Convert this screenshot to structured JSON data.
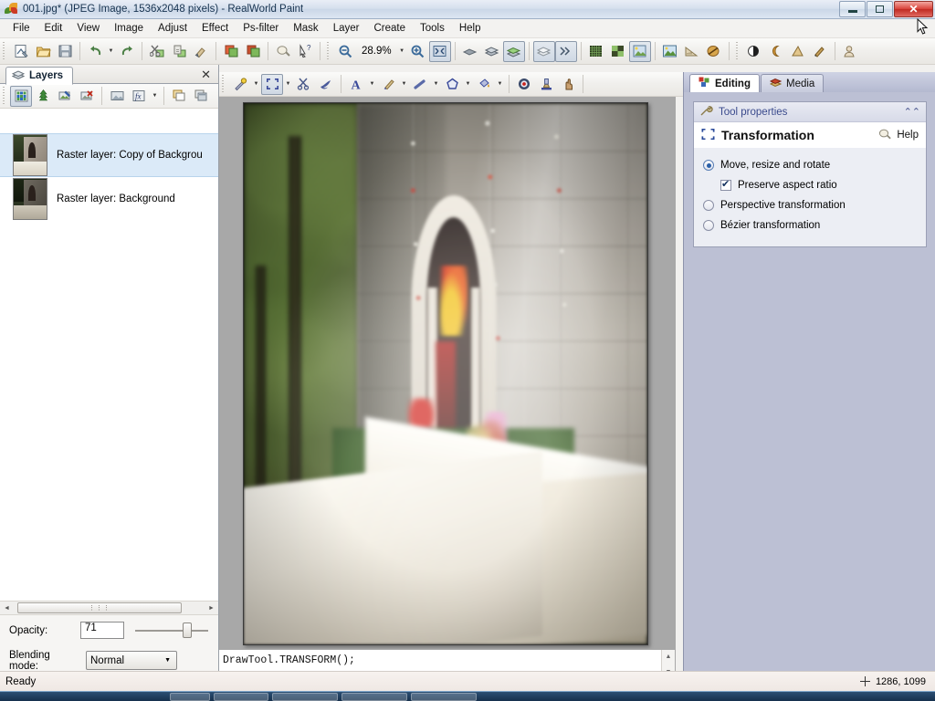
{
  "window": {
    "title": "001.jpg* (JPEG Image, 1536x2048 pixels) - RealWorld Paint",
    "app_icon": "palette-leaf-icon",
    "minimize_label": "Minimize",
    "restore_label": "Restore",
    "close_label": "Close"
  },
  "menu": {
    "items": [
      {
        "label": "File"
      },
      {
        "label": "Edit"
      },
      {
        "label": "View"
      },
      {
        "label": "Image"
      },
      {
        "label": "Adjust"
      },
      {
        "label": "Effect"
      },
      {
        "label": "Ps-filter"
      },
      {
        "label": "Mask"
      },
      {
        "label": "Layer"
      },
      {
        "label": "Create"
      },
      {
        "label": "Tools"
      },
      {
        "label": "Help"
      }
    ]
  },
  "toolbar_main": {
    "zoom_value": "28.9%",
    "buttons": [
      {
        "name": "new-document-icon",
        "title": "New"
      },
      {
        "name": "open-folder-icon",
        "title": "Open"
      },
      {
        "name": "save-disk-icon",
        "title": "Save"
      },
      {
        "name": "undo-icon",
        "title": "Undo"
      },
      {
        "name": "undo-dropdown-icon",
        "title": "Undo history"
      },
      {
        "name": "redo-icon",
        "title": "Redo"
      },
      {
        "name": "cut-scissors-icon",
        "title": "Cut"
      },
      {
        "name": "copy-icon",
        "title": "Copy"
      },
      {
        "name": "paste-brush-icon",
        "title": "Paste"
      },
      {
        "name": "crop-icon",
        "title": "Crop"
      },
      {
        "name": "resize-icon",
        "title": "Resize"
      },
      {
        "name": "color-picker-bulb-icon",
        "title": "Pick color"
      },
      {
        "name": "whats-this-help-icon",
        "title": "What's this?"
      },
      {
        "name": "zoom-out-icon",
        "title": "Zoom out"
      },
      {
        "name": "zoom-dropdown-icon",
        "title": "Zoom presets"
      },
      {
        "name": "zoom-in-icon",
        "title": "Zoom in"
      },
      {
        "name": "fit-to-window-icon",
        "title": "Fit to window"
      },
      {
        "name": "layer-flat-icon",
        "title": "Single layer"
      },
      {
        "name": "layer-stack-icon",
        "title": "Layer stack"
      },
      {
        "name": "layer-active-icon",
        "title": "Active layer"
      },
      {
        "name": "layers-panel-icon",
        "title": "Layers"
      },
      {
        "name": "animation-frames-icon",
        "title": "Frames"
      },
      {
        "name": "grid-fine-icon",
        "title": "Fine grid"
      },
      {
        "name": "grid-coarse-icon",
        "title": "Coarse grid"
      },
      {
        "name": "image-preview-icon",
        "title": "Preview"
      },
      {
        "name": "image-thumbnail-icon",
        "title": "Thumbnail"
      },
      {
        "name": "ruler-icon",
        "title": "Ruler"
      },
      {
        "name": "guides-icon",
        "title": "Guides"
      },
      {
        "name": "brightness-icon",
        "title": "Brightness"
      },
      {
        "name": "contrast-icon",
        "title": "Contrast"
      },
      {
        "name": "gamma-icon",
        "title": "Gamma"
      },
      {
        "name": "eyedropper-icon",
        "title": "Eyedropper"
      },
      {
        "name": "user-profile-icon",
        "title": "Account"
      }
    ]
  },
  "toolbar_tools": {
    "overflow_label": "»",
    "buttons": [
      {
        "name": "magic-wand-icon",
        "title": "Magic wand"
      },
      {
        "name": "selection-transform-icon",
        "title": "Transformation",
        "active": true
      },
      {
        "name": "cut-selection-icon",
        "title": "Cut selection"
      },
      {
        "name": "smudge-icon",
        "title": "Smudge"
      },
      {
        "name": "text-tool-icon",
        "title": "Text"
      },
      {
        "name": "brush-tool-icon",
        "title": "Brush"
      },
      {
        "name": "line-tool-icon",
        "title": "Line"
      },
      {
        "name": "shape-tool-icon",
        "title": "Shape"
      },
      {
        "name": "fill-bucket-icon",
        "title": "Fill"
      },
      {
        "name": "target-icon",
        "title": "Target"
      },
      {
        "name": "stamp-icon",
        "title": "Clone stamp"
      },
      {
        "name": "finger-icon",
        "title": "Finger"
      }
    ]
  },
  "layers_dock": {
    "tab_label": "Layers",
    "tab_icon": "layers-stack-icon",
    "close_icon": "close-icon",
    "toolbar_buttons": [
      {
        "name": "new-layer-icon",
        "title": "New layer"
      },
      {
        "name": "add-vector-layer-icon",
        "title": "Add vector layer"
      },
      {
        "name": "layer-properties-icon",
        "title": "Layer properties"
      },
      {
        "name": "delete-layer-icon",
        "title": "Delete layer"
      },
      {
        "name": "layer-mask-icon",
        "title": "Layer mask"
      },
      {
        "name": "layer-effects-icon",
        "title": "Layer effects"
      },
      {
        "name": "layer-effects-dropdown-icon",
        "title": "Effects menu"
      },
      {
        "name": "duplicate-layer-icon",
        "title": "Duplicate layer"
      },
      {
        "name": "merge-layers-icon",
        "title": "Merge layers"
      }
    ],
    "items": [
      {
        "label": "Raster layer: Copy of Backgrou",
        "selected": true,
        "thumb": "shrine-thumbnail"
      },
      {
        "label": "Raster layer: Background",
        "selected": false,
        "thumb": "shrine-thumbnail-dark"
      }
    ],
    "scrollbar": {
      "left_arrow": "◄",
      "right_arrow": "►",
      "thumb_grip": "⋮⋮⋮"
    },
    "opacity": {
      "label": "Opacity:",
      "value": "71"
    },
    "blending": {
      "label": "Blending mode:",
      "value": "Normal",
      "caret": "▼"
    }
  },
  "canvas": {
    "image_name": "shrine-photo",
    "description": "Soft-focus photograph of a stone wayside shrine with arched niche, flowers and bright stone wall"
  },
  "script_console": {
    "code": "DrawTool.TRANSFORM();",
    "scroll_up": "▲",
    "scroll_down": "▼"
  },
  "right_dock": {
    "tabs": [
      {
        "label": "Editing",
        "icon": "editing-cubes-icon",
        "active": true
      },
      {
        "label": "Media",
        "icon": "media-books-icon",
        "active": false
      }
    ],
    "tool_properties": {
      "header": "Tool properties",
      "header_icon": "wrench-icon",
      "collapse_icon": "chevron-up-icon",
      "title": "Transformation",
      "title_icon": "transform-corners-icon",
      "help_label": "Help",
      "help_icon": "help-bulb-icon",
      "options": [
        {
          "type": "radio",
          "label": "Move, resize and rotate",
          "checked": true
        },
        {
          "type": "checkbox",
          "label": "Preserve aspect ratio",
          "checked": true,
          "indent": true
        },
        {
          "type": "radio",
          "label": "Perspective transformation",
          "checked": false
        },
        {
          "type": "radio",
          "label": "Bézier transformation",
          "checked": false
        }
      ]
    }
  },
  "status_bar": {
    "message": "Ready",
    "coordinates": "1286, 1099",
    "coord_icon": "crosshair-icon"
  },
  "colors": {
    "title_bar": "#cbd7e8",
    "close_button": "#d9453c",
    "right_panel": "#bcc0d4",
    "selection_highlight": "#dbeaf8",
    "canvas_backdrop": "#a8a8a8",
    "panel_link": "#3a4a8c"
  }
}
